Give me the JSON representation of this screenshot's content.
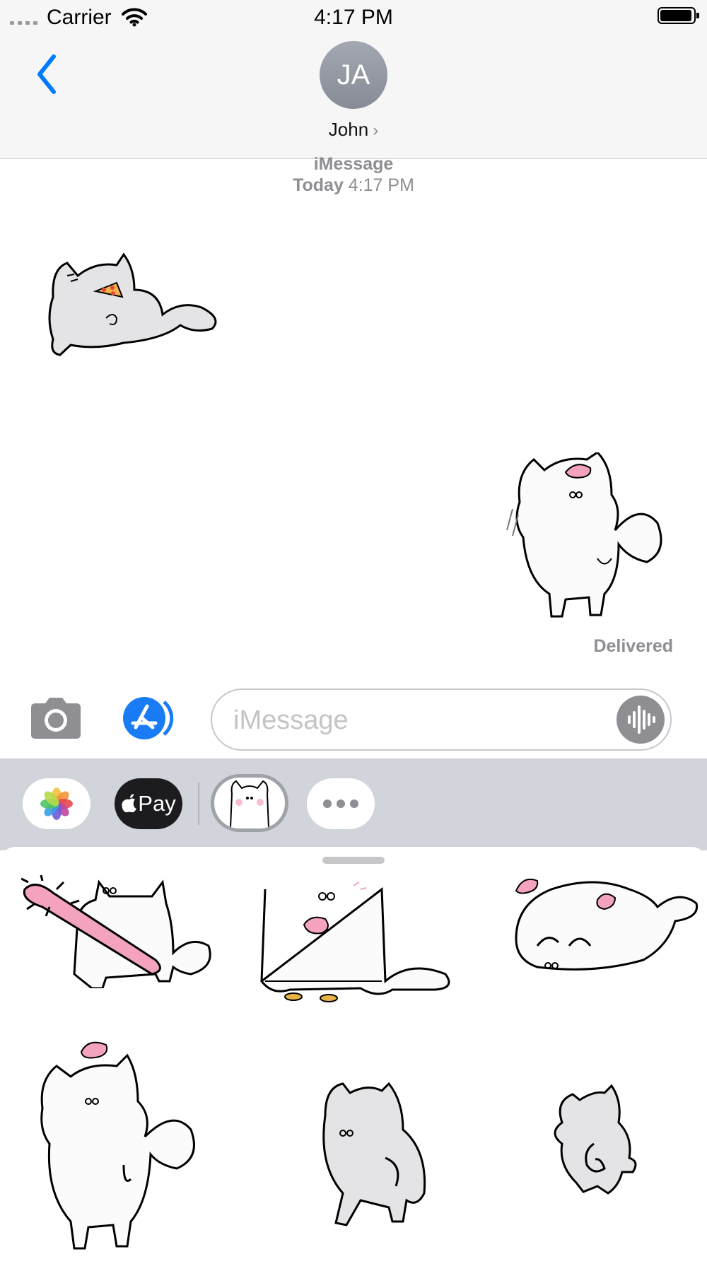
{
  "status_bar": {
    "carrier": "Carrier",
    "time": "4:17 PM",
    "battery_level": 0.95
  },
  "header": {
    "avatar_initials": "JA",
    "contact_name": "John",
    "contact_chevron": "›",
    "back_icon": "chevron-left-icon"
  },
  "conversation": {
    "service_label": "iMessage",
    "timestamp_day": "Today",
    "timestamp_time": "4:17 PM",
    "delivered_label": "Delivered",
    "messages": [
      {
        "type": "sticker",
        "sender": "contact",
        "sticker": "cat-eating-pizza"
      },
      {
        "type": "sticker",
        "sender": "me",
        "sticker": "cat-tipping-pink-cap"
      }
    ]
  },
  "compose": {
    "placeholder": "iMessage",
    "value": "",
    "camera_icon": "camera-icon",
    "appstore_icon": "app-store-icon",
    "audio_icon": "audio-waveform-icon"
  },
  "app_drawer": {
    "apps": [
      {
        "name": "Photos",
        "icon": "photos-icon"
      },
      {
        "name": "Apple Pay",
        "label": "Pay",
        "icon": "apple-icon"
      },
      {
        "name": "Cat Stickers",
        "icon": "cat-sticker-icon",
        "selected": true
      },
      {
        "name": "More",
        "icon": "more-icon"
      }
    ]
  },
  "sticker_panel": {
    "stickers": [
      "cat-with-spiked-bat",
      "cat-with-coins",
      "cat-lying-with-cap",
      "cat-tipping-cap",
      "cat-leaning",
      "cat-from-behind"
    ]
  },
  "colors": {
    "accent": "#007aff",
    "secondary_text": "#8e8e93",
    "bar_background": "#f6f6f6",
    "app_strip": "#d1d4da",
    "sticker_pink": "#f4a3bf"
  }
}
